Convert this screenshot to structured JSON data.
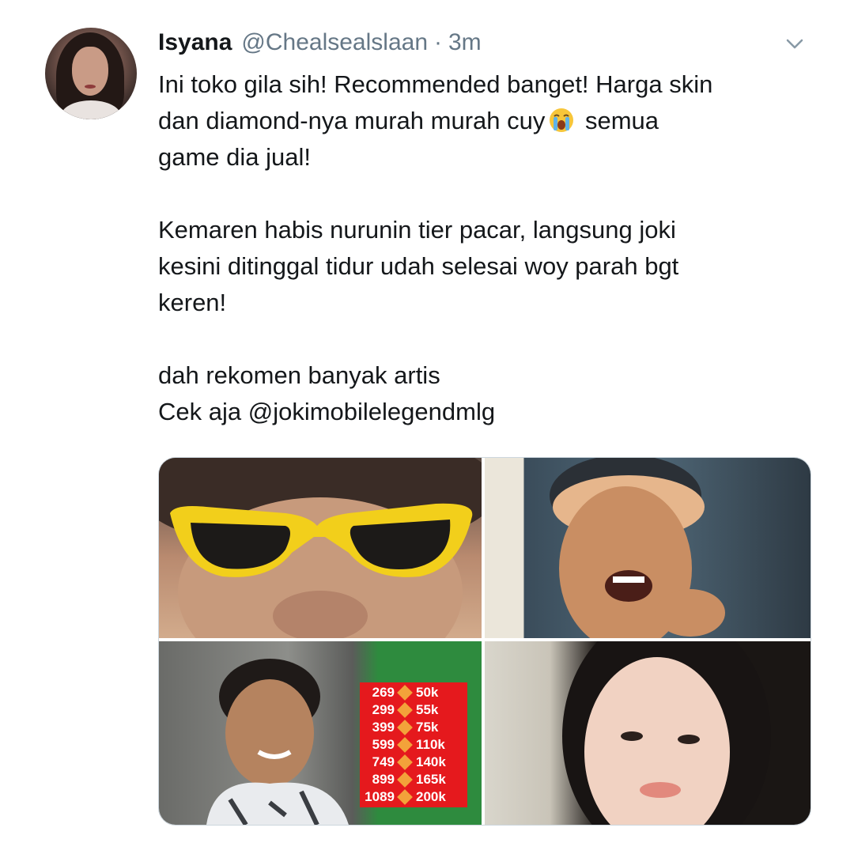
{
  "tweet": {
    "author_name": "Isyana",
    "handle": "@Chealsealslaan",
    "separator": "·",
    "time": "3m",
    "paragraphs": [
      {
        "lines": [
          "Ini toko gila sih! Recommended banget! Harga skin",
          "dan diamond-nya murah murah cuy",
          " semua",
          "game dia jual!"
        ]
      },
      {
        "lines": [
          "Kemaren habis nurunin tier pacar, langsung joki",
          "kesini ditinggal tidur udah selesai woy parah bgt",
          "keren!"
        ]
      },
      {
        "lines": [
          "dah rekomen banyak artis",
          "Cek aja @jokimobilelegendmlg"
        ]
      }
    ],
    "emoji": "loudly-crying-face-icon"
  },
  "media": {
    "price_list": [
      {
        "diamonds": "269",
        "price": "50k"
      },
      {
        "diamonds": "299",
        "price": "55k"
      },
      {
        "diamonds": "399",
        "price": "75k"
      },
      {
        "diamonds": "599",
        "price": "110k"
      },
      {
        "diamonds": "749",
        "price": "140k"
      },
      {
        "diamonds": "899",
        "price": "165k"
      },
      {
        "diamonds": "1089",
        "price": "200k"
      }
    ]
  },
  "colors": {
    "name": "#14171a",
    "muted": "#657786",
    "price_bg": "#e5191d",
    "diamond": "#f3a23a"
  }
}
